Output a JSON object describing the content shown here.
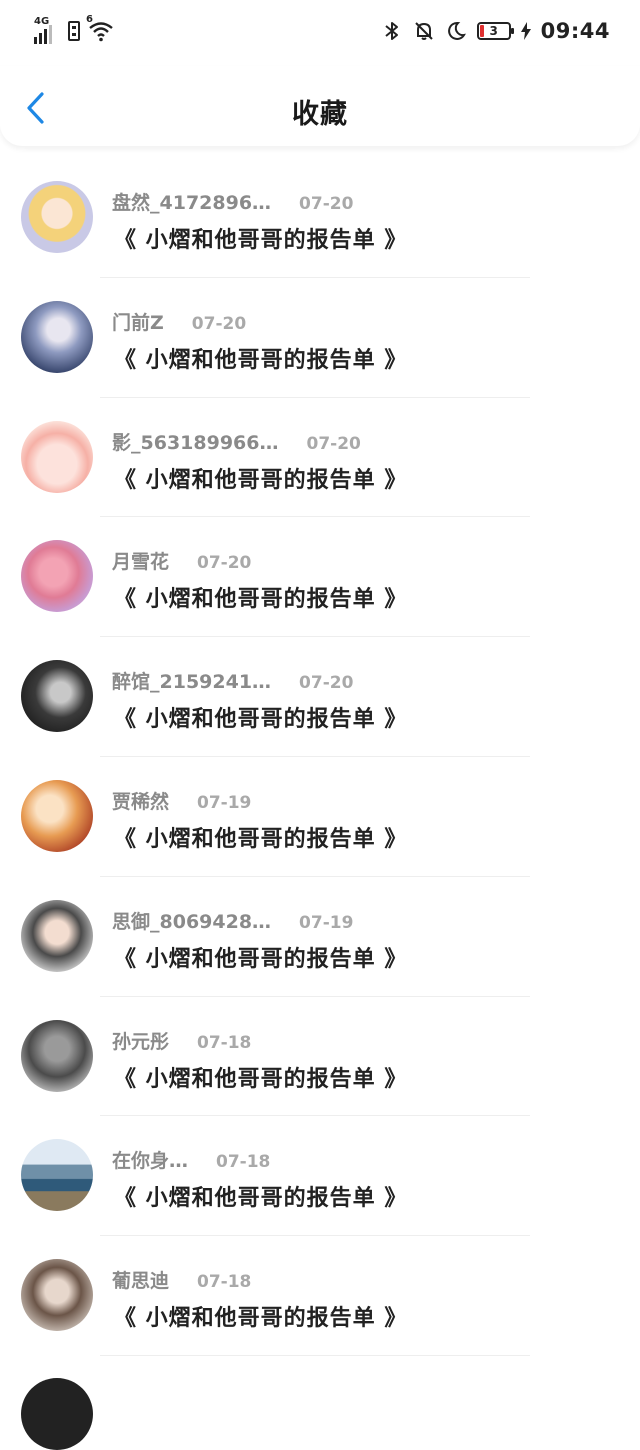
{
  "status_bar": {
    "network_type": "4G",
    "wifi_badge": "6",
    "battery_level": "3",
    "time": "09:44",
    "accent_battery_color": "#e03030"
  },
  "header": {
    "title": "收藏",
    "back_icon": "chevron-left-icon",
    "accent_color": "#1e88e5"
  },
  "favorites": [
    {
      "name": "盘然_4172896…",
      "date": "07-20",
      "title": "《 小熠和他哥哥的报告单 》"
    },
    {
      "name": "门前Z",
      "date": "07-20",
      "title": "《 小熠和他哥哥的报告单 》"
    },
    {
      "name": "影_563189966…",
      "date": "07-20",
      "title": "《 小熠和他哥哥的报告单 》"
    },
    {
      "name": "月雪花",
      "date": "07-20",
      "title": "《 小熠和他哥哥的报告单 》"
    },
    {
      "name": "醉馆_2159241…",
      "date": "07-20",
      "title": "《 小熠和他哥哥的报告单 》"
    },
    {
      "name": "贾稀然",
      "date": "07-19",
      "title": "《 小熠和他哥哥的报告单 》"
    },
    {
      "name": "思御_8069428…",
      "date": "07-19",
      "title": "《 小熠和他哥哥的报告单 》"
    },
    {
      "name": "孙元彤",
      "date": "07-18",
      "title": "《 小熠和他哥哥的报告单 》"
    },
    {
      "name": "在你身…",
      "date": "07-18",
      "title": "《 小熠和他哥哥的报告单 》"
    },
    {
      "name": "葡思迪",
      "date": "07-18",
      "title": "《 小熠和他哥哥的报告单 》"
    }
  ]
}
